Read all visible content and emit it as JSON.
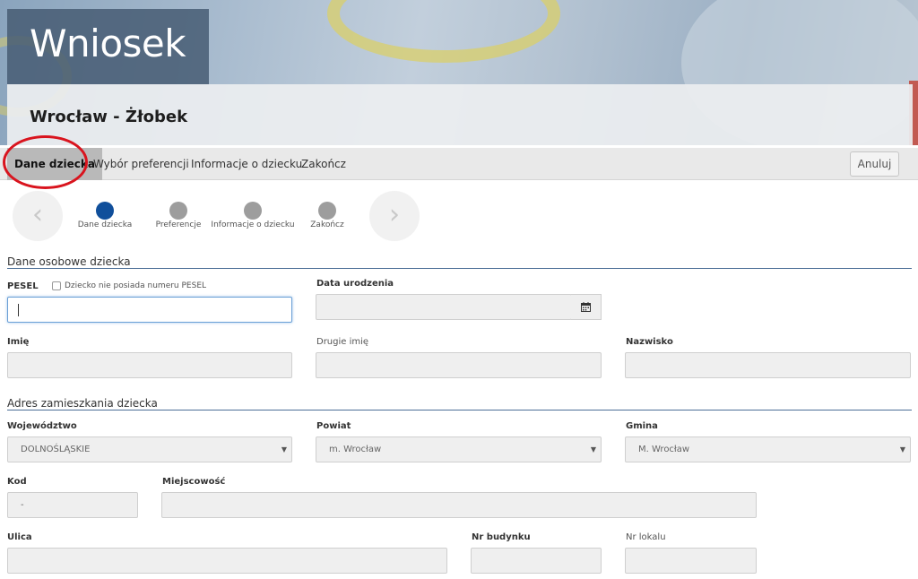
{
  "header": {
    "title": "Wniosek",
    "subtitle": "Wrocław - Żłobek"
  },
  "tabs": [
    {
      "label": "Dane dziecka",
      "active": true
    },
    {
      "label": "Wybór preferencji",
      "active": false
    },
    {
      "label": "Informacje o dziecku",
      "active": false
    },
    {
      "label": "Zakończ",
      "active": false
    }
  ],
  "cancel_label": "Anuluj",
  "stepper": {
    "prev_icon": "chevron-left-icon",
    "next_icon": "chevron-right-icon",
    "steps": [
      {
        "label": "Dane dziecka",
        "active": true
      },
      {
        "label": "Preferencje",
        "active": false
      },
      {
        "label": "Informacje o dziecku",
        "active": false
      },
      {
        "label": "Zakończ",
        "active": false
      }
    ]
  },
  "section_personal": {
    "title": "Dane osobowe dziecka",
    "pesel_label": "PESEL",
    "no_pesel_label": "Dziecko nie posiada numeru PESEL",
    "pesel_value": "",
    "birth_date_label": "Data urodzenia",
    "birth_date_value": "",
    "first_name_label": "Imię",
    "first_name_value": "",
    "second_name_label": "Drugie imię",
    "second_name_value": "",
    "last_name_label": "Nazwisko",
    "last_name_value": ""
  },
  "section_address": {
    "title": "Adres zamieszkania dziecka",
    "voivodeship_label": "Województwo",
    "voivodeship_value": "DOLNOŚLĄSKIE",
    "county_label": "Powiat",
    "county_value": "m. Wrocław",
    "commune_label": "Gmina",
    "commune_value": "M. Wrocław",
    "postal_label": "Kod",
    "postal_value": "-",
    "city_label": "Miejscowość",
    "city_value": "",
    "street_label": "Ulica",
    "street_value": "",
    "building_label": "Nr budynku",
    "building_value": "",
    "apartment_label": "Nr lokalu",
    "apartment_value": ""
  },
  "colors": {
    "accent": "#104f9b",
    "highlight_ring": "#d9141e",
    "section_line": "#4d6f97"
  }
}
